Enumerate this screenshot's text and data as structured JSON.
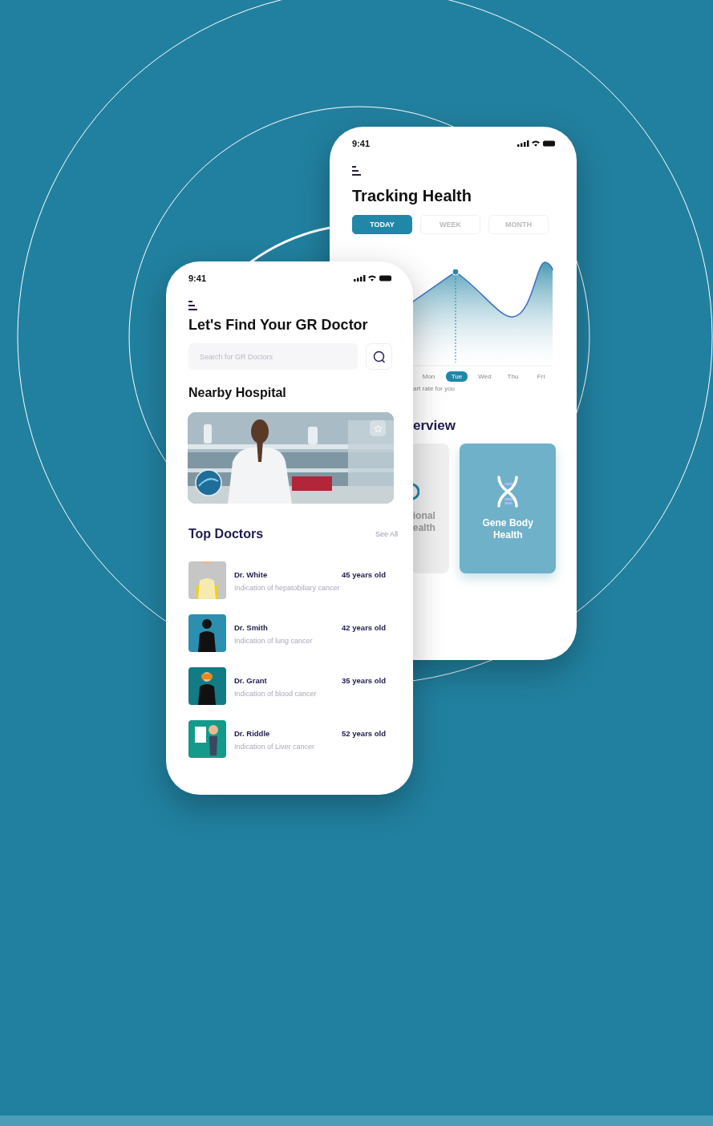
{
  "tracking_screen": {
    "status_time": "9:41",
    "title": "Tracking Health",
    "tabs": [
      {
        "label": "TODAY",
        "selected": true
      },
      {
        "label": "WEEK",
        "selected": false
      },
      {
        "label": "MONTH",
        "selected": false
      }
    ],
    "days": [
      {
        "label": "Mon",
        "selected": false
      },
      {
        "label": "Tue",
        "selected": true
      },
      {
        "label": "Wed",
        "selected": false
      },
      {
        "label": "Thu",
        "selected": false
      },
      {
        "label": "Fri",
        "selected": false
      }
    ],
    "chart_caption": "art rate for you",
    "section_title": "erview",
    "cards": [
      {
        "kind": "partial",
        "label": "ional ealth",
        "selected": false
      },
      {
        "kind": "gene",
        "label": "Gene Body Health",
        "selected": true
      }
    ]
  },
  "doctor_screen": {
    "status_time": "9:41",
    "title": "Let's Find Your GR Doctor",
    "search": {
      "placeholder": "Search for GR Doctors"
    },
    "nearby_title": "Nearby Hospital",
    "top_doctors_title": "Top Doctors",
    "see_all": "See All",
    "doctors": [
      {
        "name": "Dr. White",
        "age": "45 years old",
        "indication": "Indication of hepatobiliary cancer"
      },
      {
        "name": "Dr. Smith",
        "age": "42 years old",
        "indication": "Indication of lung cancer"
      },
      {
        "name": "Dr. Grant",
        "age": "35 years old",
        "indication": "Indication of blood cancer"
      },
      {
        "name": "Dr. Riddle",
        "age": "52 years old",
        "indication": "Indication of Liver cancer"
      }
    ]
  }
}
